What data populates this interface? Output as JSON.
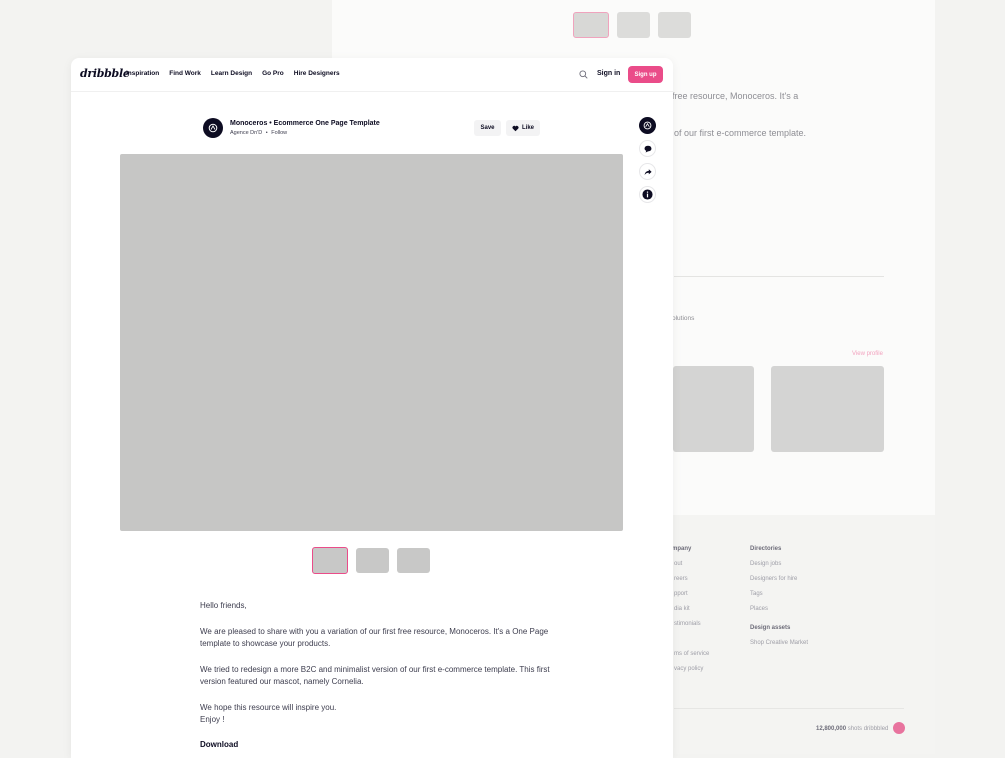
{
  "background_page": {
    "thumbnails": [
      {
        "active": true
      },
      {
        "active": false
      },
      {
        "active": false
      }
    ],
    "text_line1": "free resource, Monoceros. It's a",
    "text_line2": "of our first e-commerce template.",
    "text_solutions": "olutions",
    "view_profile": "View profile",
    "footer": {
      "company_heading": "mpany",
      "company_items": [
        "out",
        "reers",
        "pport",
        "dia kit",
        "stimonials",
        "",
        "ms of service",
        "vacy policy"
      ],
      "directories_heading": "Directories",
      "directories_items": [
        "Design jobs",
        "Designers for hire",
        "Tags",
        "Places"
      ],
      "assets_heading": "Design assets",
      "assets_items": [
        "Shop Creative Market"
      ],
      "shots_count": "12,800,000",
      "shots_label": "shots dribbbled"
    }
  },
  "nav": {
    "logo": "dribbble",
    "links": [
      "Inspiration",
      "Find Work",
      "Learn Design",
      "Go Pro",
      "Hire Designers"
    ],
    "sign_in": "Sign in",
    "sign_up": "Sign up"
  },
  "shot": {
    "title": "Monoceros • Ecommerce One Page Template",
    "author": "Agence Dn'D",
    "separator": "•",
    "follow": "Follow",
    "save": "Save",
    "like": "Like"
  },
  "description": {
    "p1": "Hello friends,",
    "p2": "We are pleased to share with you a variation of our first free resource, Monoceros. It's a One Page template to showcase your products.",
    "p3": "We tried to redesign a more B2C and minimalist version of our first e-commerce template. This first version featured our mascot, namely Cornelia.",
    "p4a": "We hope this resource will inspire you.",
    "p4b": "Enjoy !",
    "download": "Download"
  },
  "colors": {
    "accent": "#ea4c89",
    "text": "#0d0c22",
    "placeholder": "#c6c6c5"
  }
}
